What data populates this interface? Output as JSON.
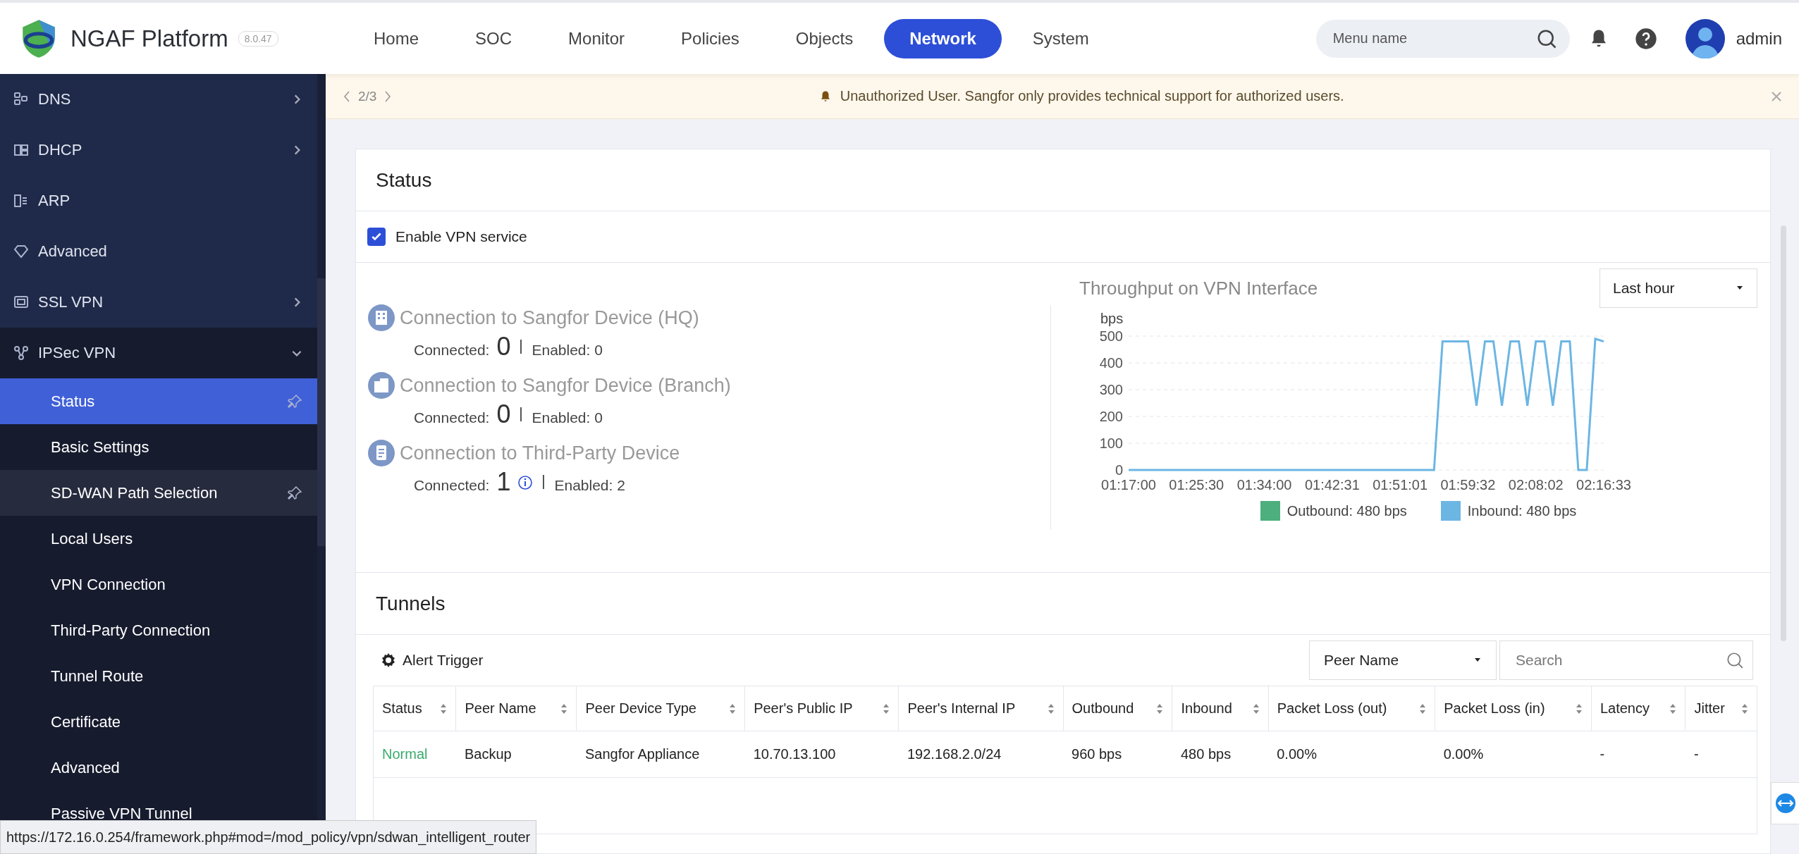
{
  "header": {
    "product": "NGAF Platform",
    "version": "8.0.47",
    "nav": [
      {
        "label": "Home",
        "selected": false
      },
      {
        "label": "SOC",
        "selected": false
      },
      {
        "label": "Monitor",
        "selected": false
      },
      {
        "label": "Policies",
        "selected": false
      },
      {
        "label": "Objects",
        "selected": false
      },
      {
        "label": "Network",
        "selected": true
      },
      {
        "label": "System",
        "selected": false
      }
    ],
    "search": {
      "placeholder": "Menu name"
    },
    "user": "admin"
  },
  "sidebar": {
    "items": [
      {
        "label": "DNS",
        "expanded": false,
        "selected": false,
        "highlighted": false
      },
      {
        "label": "DHCP",
        "expanded": false,
        "selected": false,
        "highlighted": false
      },
      {
        "label": "ARP",
        "selected": false,
        "highlighted": false
      },
      {
        "label": "Advanced",
        "selected": false,
        "highlighted": false
      },
      {
        "label": "SSL VPN",
        "expanded": false,
        "selected": false,
        "highlighted": false
      },
      {
        "label": "IPSec VPN",
        "expanded": true,
        "selected": false,
        "highlighted": false,
        "children": [
          {
            "label": "Status",
            "selected": true,
            "highlighted": false
          },
          {
            "label": "Basic Settings",
            "selected": false,
            "highlighted": false
          },
          {
            "label": "SD-WAN Path Selection",
            "selected": false,
            "highlighted": true
          },
          {
            "label": "Local Users",
            "selected": false,
            "highlighted": false
          },
          {
            "label": "VPN Connection",
            "selected": false,
            "highlighted": false
          },
          {
            "label": "Third-Party Connection",
            "selected": false,
            "highlighted": false
          },
          {
            "label": "Tunnel Route",
            "selected": false,
            "highlighted": false
          },
          {
            "label": "Certificate",
            "selected": false,
            "highlighted": false
          },
          {
            "label": "Advanced",
            "selected": false,
            "highlighted": false
          },
          {
            "label": "Passive VPN Tunnel",
            "selected": false,
            "highlighted": false
          }
        ]
      }
    ]
  },
  "banner": {
    "pager": "2/3",
    "message": "Unauthorized User. Sangfor only provides technical support for authorized users."
  },
  "status": {
    "title": "Status",
    "enable_vpn": {
      "label": "Enable VPN service",
      "checked": true
    },
    "connections": [
      {
        "title": "Connection to Sangfor Device (HQ)",
        "connected_label": "Connected:",
        "connected": "0",
        "info": false,
        "enabled": "Enabled: 0"
      },
      {
        "title": "Connection to Sangfor Device (Branch)",
        "connected_label": "Connected:",
        "connected": "0",
        "info": false,
        "enabled": "Enabled: 0"
      },
      {
        "title": "Connection to Third-Party Device",
        "connected_label": "Connected:",
        "connected": "1",
        "info": true,
        "enabled": "Enabled: 2"
      }
    ],
    "throughput": {
      "title": "Throughput on VPN Interface",
      "range": "Last hour",
      "chart_data": {
        "type": "line",
        "ylabel": "bps",
        "grid": true,
        "ylim": [
          0,
          500
        ],
        "yticks": [
          0,
          100,
          200,
          300,
          400,
          500
        ],
        "categories": [
          "01:17:00",
          null,
          null,
          null,
          null,
          null,
          null,
          null,
          "01:25:30",
          null,
          null,
          null,
          null,
          null,
          null,
          null,
          "01:34:00",
          null,
          null,
          null,
          null,
          null,
          null,
          null,
          "01:42:31",
          null,
          null,
          null,
          null,
          null,
          null,
          null,
          "01:51:01",
          null,
          null,
          null,
          null,
          null,
          null,
          null,
          "01:59:32",
          null,
          null,
          null,
          null,
          null,
          null,
          null,
          "02:08:02",
          null,
          null,
          null,
          null,
          null,
          null,
          null,
          "02:16:33"
        ],
        "series": [
          {
            "name": "Outbound: 480 bps",
            "color": "#4caf7d",
            "values": [
              null,
              null,
              null,
              null,
              null,
              null,
              null,
              null,
              null,
              null,
              null,
              null,
              null,
              null,
              null,
              null,
              null,
              null,
              null,
              null,
              null,
              null,
              null,
              null,
              null,
              null,
              null,
              null,
              null,
              null,
              null,
              null,
              null,
              null,
              null,
              null,
              null,
              null,
              null,
              null,
              null,
              null,
              null,
              null,
              null,
              null,
              null,
              null,
              null,
              null,
              null,
              null,
              null,
              null,
              null,
              null,
              null
            ]
          },
          {
            "name": "Inbound: 480 bps",
            "color": "#6cb6e4",
            "values": [
              0,
              0,
              0,
              0,
              0,
              0,
              0,
              0,
              0,
              0,
              0,
              0,
              0,
              0,
              0,
              0,
              0,
              0,
              0,
              0,
              0,
              0,
              0,
              0,
              0,
              0,
              0,
              0,
              0,
              0,
              0,
              0,
              0,
              0,
              0,
              0,
              0,
              480,
              480,
              480,
              480,
              240,
              480,
              480,
              240,
              480,
              480,
              240,
              480,
              480,
              240,
              480,
              480,
              0,
              0,
              490,
              480
            ]
          }
        ]
      }
    }
  },
  "tunnels": {
    "title": "Tunnels",
    "alert_trigger": "Alert Trigger",
    "filter": "Peer Name",
    "search": {
      "placeholder": "Search"
    },
    "columns": [
      "Status",
      "Peer Name",
      "Peer Device Type",
      "Peer's Public IP",
      "Peer's Internal IP",
      "Outbound",
      "Inbound",
      "Packet Loss (out)",
      "Packet Loss (in)",
      "Latency",
      "Jitter"
    ],
    "rows": [
      [
        "Normal",
        "Backup",
        "Sangfor Appliance",
        "10.70.13.100",
        "192.168.2.0/24",
        "960 bps",
        "480 bps",
        "0.00%",
        "0.00%",
        "-",
        "-"
      ]
    ]
  },
  "status_bar": {
    "url": "https://172.16.0.254/framework.php#mod=/mod_policy/vpn/sdwan_intelligent_router"
  }
}
